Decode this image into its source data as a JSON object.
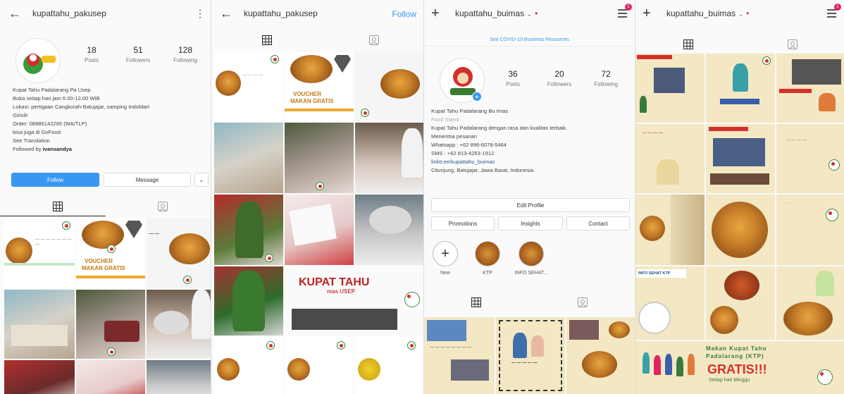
{
  "panel1": {
    "username": "kupattahu_pakusep",
    "stats": [
      {
        "num": "18",
        "label": "Posts"
      },
      {
        "num": "51",
        "label": "Followers"
      },
      {
        "num": "128",
        "label": "Following"
      }
    ],
    "bio": [
      "Kupat Tahu Padalarang Pa Usep",
      "Buka setiap hari jam 6.00-12.00 WIB",
      "Lokasi: pertigaan Cangkorah-Batujajar, samping IndoMart",
      "Girisih",
      "Order: 08986142295 (WA/TLP)",
      "bisa juga di GoFood",
      "See Translation"
    ],
    "followed_prefix": "Followed by ",
    "followed_user": "ivansandya",
    "follow_button": "Follow",
    "message_button": "Message"
  },
  "panel2": {
    "username": "kupattahu_pakusep",
    "follow_link": "Follow"
  },
  "panel3": {
    "username": "kupattahu_buimas",
    "covid_banner": "See COVID-19 Business Resources",
    "badge_count": "1",
    "stats": [
      {
        "num": "36",
        "label": "Posts"
      },
      {
        "num": "20",
        "label": "Followers"
      },
      {
        "num": "72",
        "label": "Following"
      }
    ],
    "bio": {
      "name": "Kupat Tahu Padalarang Bu Imas",
      "category": "Food Stand",
      "lines": [
        "Kupat Tahu Padalarang dengan rasa dan kualitas terbaik.",
        "Menerima pesanan",
        "Whatsapp : +62 896-6078-5464",
        "SMS : +62 813-4253-1912"
      ],
      "link": "linktr.ee/kupattahu_buimas",
      "location": "Citunjung, Batujajar, Jawa Barat, Indonesia"
    },
    "edit_profile": "Edit Profile",
    "promotions": "Promotions",
    "insights": "Insights",
    "contact": "Contact",
    "highlights": [
      {
        "label": "New"
      },
      {
        "label": "KTP"
      },
      {
        "label": "INFO SEHAT..."
      }
    ]
  },
  "panel4": {
    "username": "kupattahu_buimas",
    "badge_count": "1",
    "promo_line1": "Makan Kupat Tahu",
    "promo_line2": "Padalarang (KTP)",
    "promo_gratis": "GRATIS!!!",
    "promo_sub": "Setiap hari Minggu"
  },
  "post_texts": {
    "voucher": "VOUCHER",
    "makan_gratis": "MAKAN GRATIS",
    "kupat_tahu": "KUPAT TAHU",
    "masusep": "mas USEP",
    "info_sehat": "INFO SEHAT KTP"
  },
  "colors": {
    "accent_blue": "#3897f0",
    "notification_red": "#e0245e",
    "brand_orange": "#f0a830",
    "cream": "#f3e7c4"
  }
}
